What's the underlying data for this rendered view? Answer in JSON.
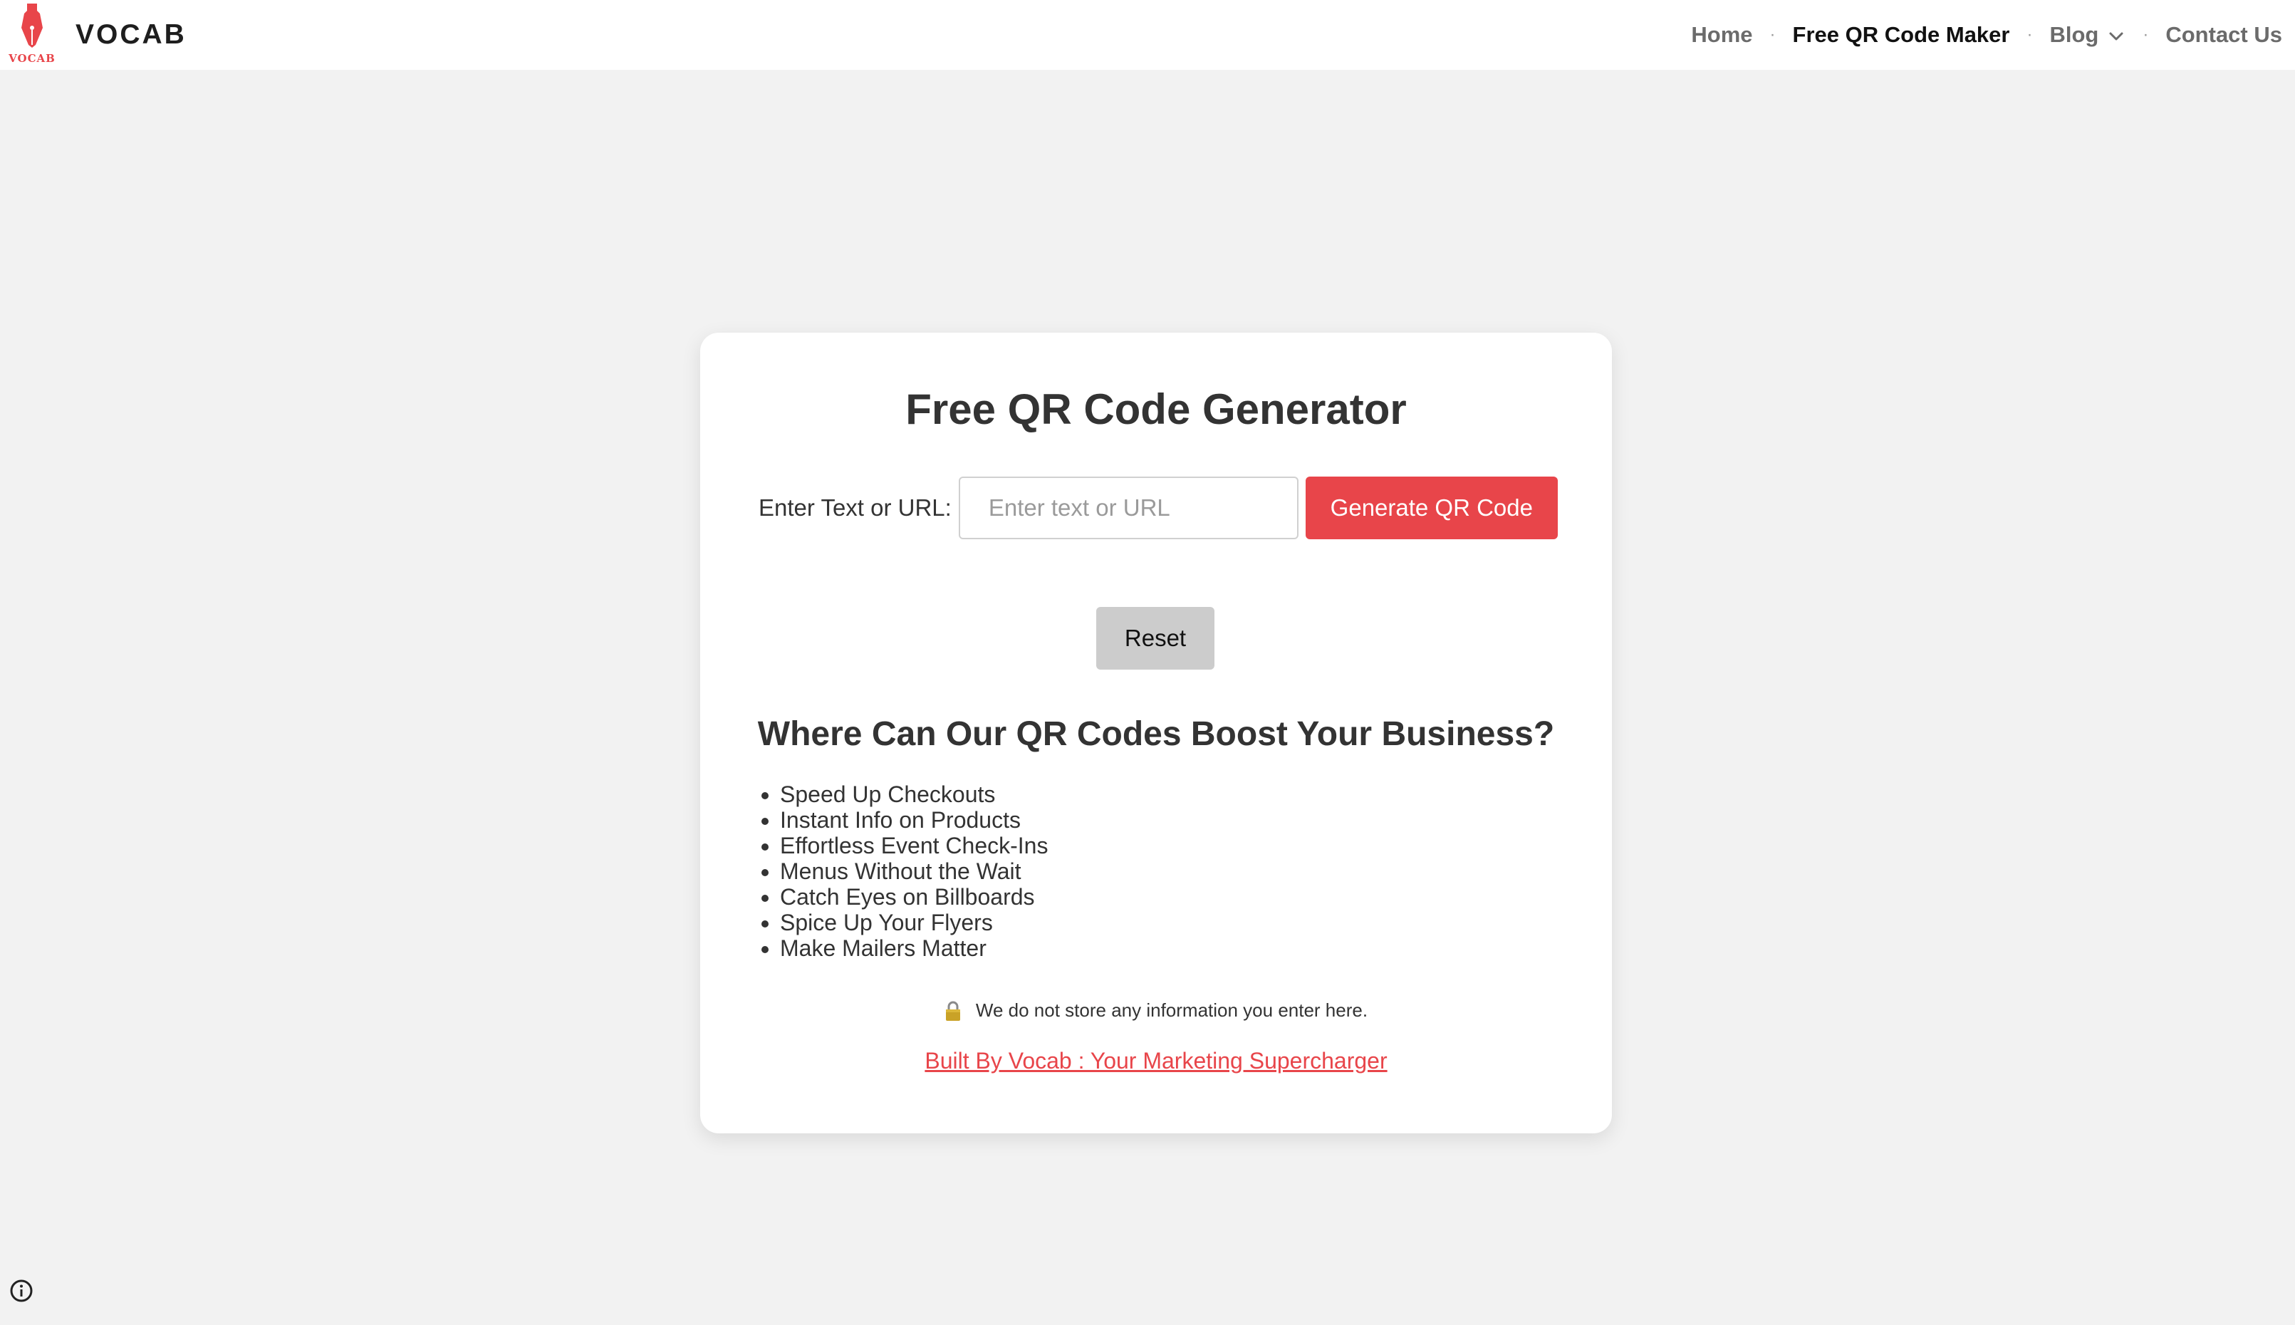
{
  "header": {
    "brand": {
      "mark_text": "VOCAB",
      "name": "VOCAB"
    },
    "nav": {
      "home": "Home",
      "qr_maker": "Free QR Code Maker",
      "blog": "Blog",
      "contact": "Contact Us",
      "separator": "·"
    }
  },
  "card": {
    "title": "Free QR Code Generator",
    "form": {
      "label": "Enter Text or URL:",
      "input_value": "",
      "input_placeholder": "Enter text or URL",
      "generate_label": "Generate QR Code",
      "reset_label": "Reset"
    },
    "section_heading": "Where Can Our QR Codes Boost Your Business?",
    "benefits": [
      "Speed Up Checkouts",
      "Instant Info on Products",
      "Effortless Event Check-Ins",
      "Menus Without the Wait",
      "Catch Eyes on Billboards",
      "Spice Up Your Flyers",
      "Make Mailers Matter"
    ],
    "privacy_note": "We do not store any information you enter here.",
    "built_by": "Built By Vocab : Your Marketing Supercharger"
  },
  "icons": {
    "brand": "fountain-pen-nib-icon",
    "blog_dropdown": "chevron-down-icon",
    "privacy": "lock-icon",
    "info": "info-circle-icon"
  },
  "colors": {
    "accent": "#e8454a",
    "background": "#f2f2f2",
    "card": "#ffffff",
    "reset_button": "#cccccc"
  }
}
